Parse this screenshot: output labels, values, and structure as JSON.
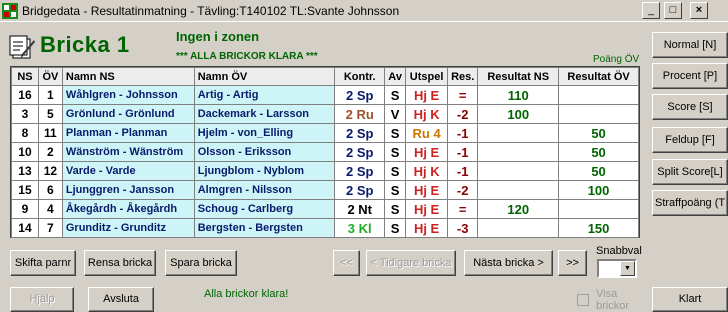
{
  "window": {
    "title": "Bridgedata - Resultatinmatning - Tävling:T140102 TL:Svante Johnsson",
    "minimize": "_",
    "maximize": "□",
    "close": "×"
  },
  "header": {
    "bricka_title": "Bricka 1",
    "zone_text": "Ingen i zonen",
    "status_banner": "*** ALLA BRICKOR KLARA ***",
    "poang_label": "Poäng ÖV"
  },
  "table": {
    "columns": [
      "NS",
      "ÖV",
      "Namn NS",
      "Namn ÖV",
      "Kontr.",
      "Av",
      "Utspel",
      "Res.",
      "Resultat NS",
      "Resultat ÖV"
    ],
    "rows": [
      {
        "ns": "16",
        "ov": "1",
        "namn_ns": "Wåhlgren - Johnsson",
        "namn_ov": "Artig - Artig",
        "kontr": "2 Sp",
        "kontr_color": "blue",
        "av": "S",
        "utspel": "Hj E",
        "utspel_color": "red",
        "res": "=",
        "res_color": "green",
        "res_ns": "110",
        "res_ov": ""
      },
      {
        "ns": "3",
        "ov": "5",
        "namn_ns": "Grönlund - Grönlund",
        "namn_ov": "Dackemark - Larsson",
        "kontr": "2 Ru",
        "kontr_color": "brown",
        "av": "V",
        "utspel": "Hj K",
        "utspel_color": "red",
        "res": "-2",
        "res_color": "darkred",
        "res_ns": "100",
        "res_ov": ""
      },
      {
        "ns": "8",
        "ov": "11",
        "namn_ns": "Planman - Planman",
        "namn_ov": "Hjelm - von_Elling",
        "kontr": "2 Sp",
        "kontr_color": "blue",
        "av": "S",
        "utspel": "Ru 4",
        "utspel_color": "orange",
        "res": "-1",
        "res_color": "darkred",
        "res_ns": "",
        "res_ov": "50"
      },
      {
        "ns": "10",
        "ov": "2",
        "namn_ns": "Wänström - Wänström",
        "namn_ov": "Olsson - Eriksson",
        "kontr": "2 Sp",
        "kontr_color": "blue",
        "av": "S",
        "utspel": "Hj E",
        "utspel_color": "red",
        "res": "-1",
        "res_color": "darkred",
        "res_ns": "",
        "res_ov": "50"
      },
      {
        "ns": "13",
        "ov": "12",
        "namn_ns": "Varde - Varde",
        "namn_ov": "Ljungblom - Nyblom",
        "kontr": "2 Sp",
        "kontr_color": "blue",
        "av": "S",
        "utspel": "Hj K",
        "utspel_color": "red",
        "res": "-1",
        "res_color": "darkred",
        "res_ns": "",
        "res_ov": "50"
      },
      {
        "ns": "15",
        "ov": "6",
        "namn_ns": "Ljunggren - Jansson",
        "namn_ov": "Almgren - Nilsson",
        "kontr": "2 Sp",
        "kontr_color": "blue",
        "av": "S",
        "utspel": "Hj E",
        "utspel_color": "red",
        "res": "-2",
        "res_color": "darkred",
        "res_ns": "",
        "res_ov": "100"
      },
      {
        "ns": "9",
        "ov": "4",
        "namn_ns": "Åkegårdh - Åkegårdh",
        "namn_ov": "Schoug - Carlberg",
        "kontr": "2 Nt",
        "kontr_color": "black",
        "av": "S",
        "utspel": "Hj E",
        "utspel_color": "red",
        "res": "=",
        "res_color": "green",
        "res_ns": "120",
        "res_ov": ""
      },
      {
        "ns": "14",
        "ov": "7",
        "namn_ns": "Grunditz - Grunditz",
        "namn_ov": "Bergsten - Bergsten",
        "kontr": "3 Kl",
        "kontr_color": "green",
        "av": "S",
        "utspel": "Hj E",
        "utspel_color": "red",
        "res": "-3",
        "res_color": "darkred",
        "res_ns": "",
        "res_ov": "150"
      }
    ]
  },
  "side_buttons": [
    "Normal [N]",
    "Procent [P]",
    "Score [S]",
    "Feldup [F]",
    "Split Score[L]",
    "Straffpoäng (T"
  ],
  "bottom_buttons": {
    "skifta": "Skifta parnr",
    "rensa": "Rensa bricka",
    "spara": "Spara bricka",
    "first": "<<",
    "prev": "< Tidigare bricka",
    "next": "Nästa bricka >",
    "last": ">>",
    "hjalp": "Hjälp",
    "avsluta": "Avsluta",
    "klart": "Klart"
  },
  "snabbval": {
    "label": "Snabbval",
    "value": ""
  },
  "status_text": "Alla brickor klara!",
  "visa_brickor": {
    "label": "Visa brickor",
    "checked": false
  },
  "colors": {
    "blue": "#0a1a6b",
    "brown": "#a0522d",
    "red": "#cc2222",
    "green": "#22aa22",
    "darkred": "#8b0000",
    "orange": "#c87800",
    "black": "#000000",
    "name_bg": "#cdf5f8",
    "heading_green": "#006400"
  }
}
